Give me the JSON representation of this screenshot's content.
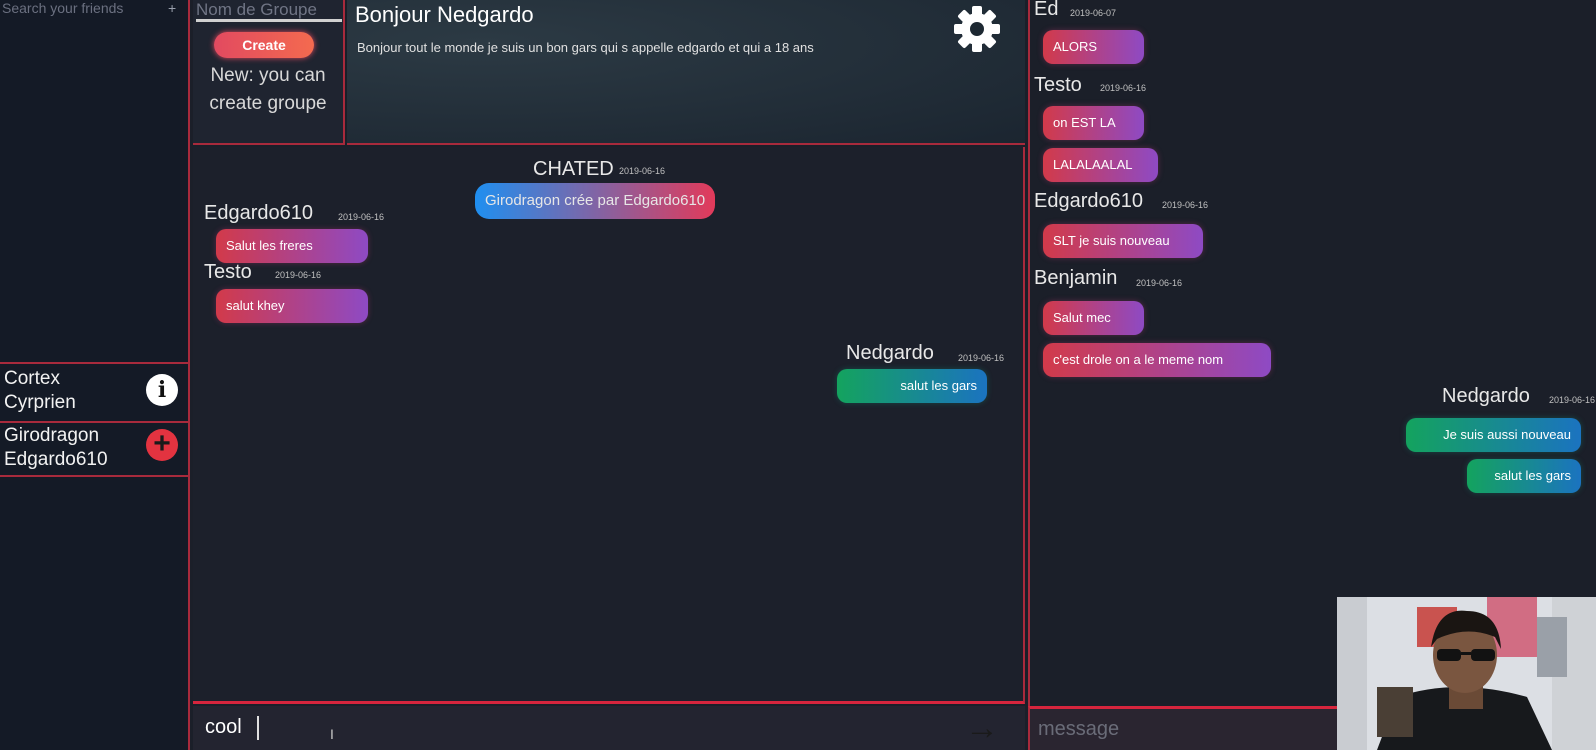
{
  "sidebar": {
    "search_placeholder": "Search your friends",
    "search_plus": "+",
    "friends": [
      {
        "line1": "Cortex",
        "line2": "Cyrprien",
        "icon": "info-icon",
        "icon_glyph": "i"
      },
      {
        "line1": "Girodragon",
        "line2": "Edgardo610",
        "icon": "add-icon",
        "icon_glyph": "+"
      }
    ]
  },
  "group_panel": {
    "input_placeholder": "Nom de Groupe",
    "create_label": "Create",
    "note": "New: you can create groupe"
  },
  "header": {
    "title": "Bonjour Nedgardo",
    "description": "Bonjour tout le monde je suis un bon gars qui s appelle edgardo et qui a 18 ans",
    "settings_icon": "gear-icon"
  },
  "main_chat": {
    "system": {
      "name": "CHATED",
      "date": "2019-06-16",
      "message": "Girodragon crée par Edgardo610"
    },
    "messages": [
      {
        "author": "Edgardo610",
        "date": "2019-06-16",
        "text": "Salut les freres"
      },
      {
        "author": "Testo",
        "date": "2019-06-16",
        "text": "salut khey"
      },
      {
        "author": "Nedgardo",
        "date": "2019-06-16",
        "text": "salut les gars"
      }
    ],
    "input_value": "cool",
    "send_icon": "arrow-right-icon",
    "send_glyph": "→"
  },
  "side_chat": {
    "groups": [
      {
        "author": "Ed",
        "date": "2019-06-07",
        "messages": [
          "ALORS"
        ]
      },
      {
        "author": "Testo",
        "date": "2019-06-16",
        "messages": [
          "on EST LA",
          "LALALAALAL"
        ]
      },
      {
        "author": "Edgardo610",
        "date": "2019-06-16",
        "messages": [
          "SLT je suis nouveau"
        ]
      },
      {
        "author": "Benjamin",
        "date": "2019-06-16",
        "messages": [
          "Salut mec",
          "c'est drole on a le meme nom"
        ]
      },
      {
        "author": "Nedgardo",
        "date": "2019-06-16",
        "messages": [
          "Je suis aussi nouveau",
          "salut les gars"
        ]
      }
    ],
    "input_placeholder": "message"
  },
  "colors": {
    "accent_red": "#a82a3c",
    "bubble_gradient_start": "#d23a4a",
    "bubble_gradient_end": "#8e4ac4",
    "own_bubble_start": "#14a35e",
    "own_bubble_end": "#1b73c0"
  }
}
